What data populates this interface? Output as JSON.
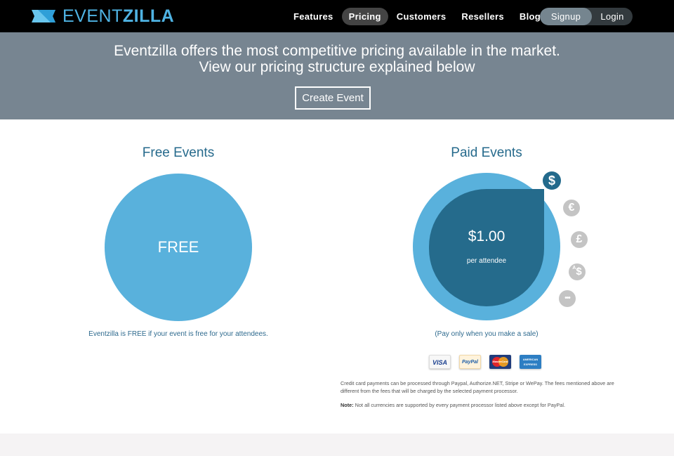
{
  "brand": {
    "logo_light": "EVENT",
    "logo_bold": "ZILLA",
    "color": "#4fb3e3"
  },
  "nav": {
    "items": [
      {
        "label": "Features",
        "active": false
      },
      {
        "label": "Pricing",
        "active": true
      },
      {
        "label": "Customers",
        "active": false
      },
      {
        "label": "Resellers",
        "active": false
      },
      {
        "label": "Blog",
        "active": false
      }
    ],
    "signup_label": "Signup",
    "login_label": "Login"
  },
  "hero": {
    "line1": "Eventzilla offers the most competitive pricing available in the market.",
    "line2": "View our pricing structure explained below",
    "cta_label": "Create Event"
  },
  "free": {
    "title": "Free Events",
    "badge": "FREE",
    "caption": "Eventzilla is FREE if your event is free for your attendees."
  },
  "paid": {
    "title": "Paid Events",
    "price": "$1.00",
    "unit": "per attendee",
    "caption": "(Pay only when you make a sale)",
    "currencies": [
      {
        "symbol": "$",
        "name": "usd",
        "selected": true
      },
      {
        "symbol": "€",
        "name": "eur",
        "selected": false
      },
      {
        "symbol": "£",
        "name": "gbp",
        "selected": false
      },
      {
        "symbol": "$",
        "prefix": "A",
        "name": "aud",
        "selected": false
      },
      {
        "symbol": "•••",
        "name": "more",
        "selected": false
      }
    ],
    "cards": {
      "visa": "VISA",
      "paypal": "PayPal",
      "mastercard": "MasterCard",
      "amex_line1": "AMERICAN",
      "amex_line2": "EXPRESS"
    },
    "note1": "Credit card payments can be processed through Paypal, Authorize.NET, Stripe or WePay. The fees mentioned above are different from the fees that will be charged by the selected payment processor.",
    "note2_label": "Note:",
    "note2_text": " Not all currencies are supported by every payment processor listed above except for PayPal."
  },
  "colors": {
    "header_bg": "#000000",
    "hero_bg": "#778591",
    "light_blue": "#59b1dc",
    "dark_blue": "#256b8c",
    "title_blue": "#266a8c",
    "footer_bg": "#f5f3f4"
  }
}
